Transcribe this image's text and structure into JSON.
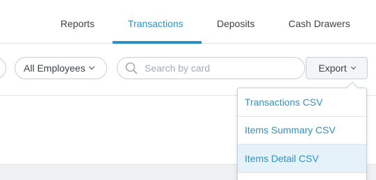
{
  "tabs": [
    {
      "label": "Reports"
    },
    {
      "label": "Transactions",
      "active": true
    },
    {
      "label": "Deposits"
    },
    {
      "label": "Cash Drawers"
    }
  ],
  "filters": {
    "employees_label": "All Employees"
  },
  "search": {
    "placeholder": "Search by card",
    "value": ""
  },
  "export": {
    "label": "Export",
    "menu": [
      {
        "label": "Transactions CSV"
      },
      {
        "label": "Items Summary CSV"
      },
      {
        "label": "Items Detail CSV",
        "highlighted": true
      }
    ]
  },
  "colors": {
    "accent": "#2b93c4",
    "hover_bg": "#e5f2f9",
    "border": "#c9cdd1"
  }
}
